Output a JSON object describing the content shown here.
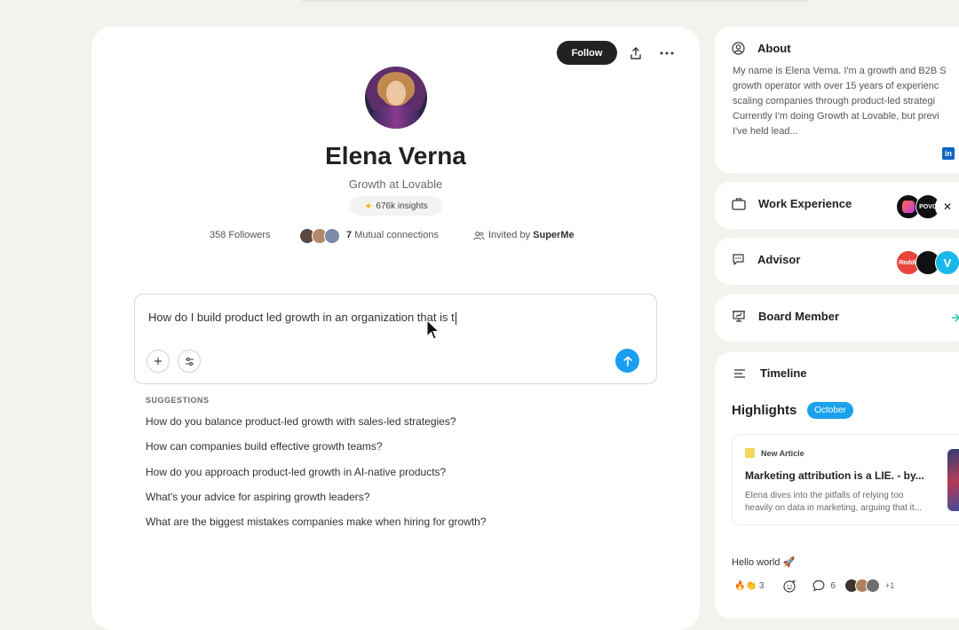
{
  "profile": {
    "name": "Elena Verna",
    "role": "Growth at Lovable",
    "insights": "676k insights",
    "followers": "358 Followers",
    "mutual_count": "7",
    "mutual_label": "Mutual connections",
    "invited_label": "Invited by",
    "invited_by": "SuperMe",
    "follow_label": "Follow"
  },
  "ask": {
    "text": "How do I build product led growth in an organization that is t"
  },
  "suggestions": {
    "title": "SUGGESTIONS",
    "items": [
      "How do you balance product-led growth with sales-led strategies?",
      "How can companies build effective growth teams?",
      "How do you approach product-led growth in AI-native products?",
      "What's your advice for aspiring growth leaders?",
      "What are the biggest mistakes companies make when hiring for growth?"
    ]
  },
  "about": {
    "title": "About",
    "text": "My name is Elena Verna. I'm a growth and B2B S\ngrowth operator with over 15 years of experienc\nscaling companies through product-led strategi\nCurrently I'm doing Growth at Lovable, but previ\nI've held lead...",
    "linkedin": "in"
  },
  "sections": {
    "work": "Work Experience",
    "advisor": "Advisor",
    "board": "Board Member",
    "timeline": "Timeline"
  },
  "logos": {
    "work_2": "POVC",
    "advisor_1": "Reddit"
  },
  "highlights": {
    "title": "Highlights",
    "month": "October",
    "article_badge": "New Article",
    "article_title": "Marketing attribution is a LIE. - by...",
    "article_desc": "Elena dives into the pitfalls of relying too\nheavily on data in marketing, arguing that it...",
    "post_text": "Hello world 🚀",
    "reaction_emoji": "🔥👏",
    "reaction_count": "3",
    "comment_count": "6",
    "more_reactors": "+1"
  },
  "colors": {
    "accent": "#1a9ef0",
    "follow_bg": "#222222",
    "background": "#f4f2ec"
  }
}
